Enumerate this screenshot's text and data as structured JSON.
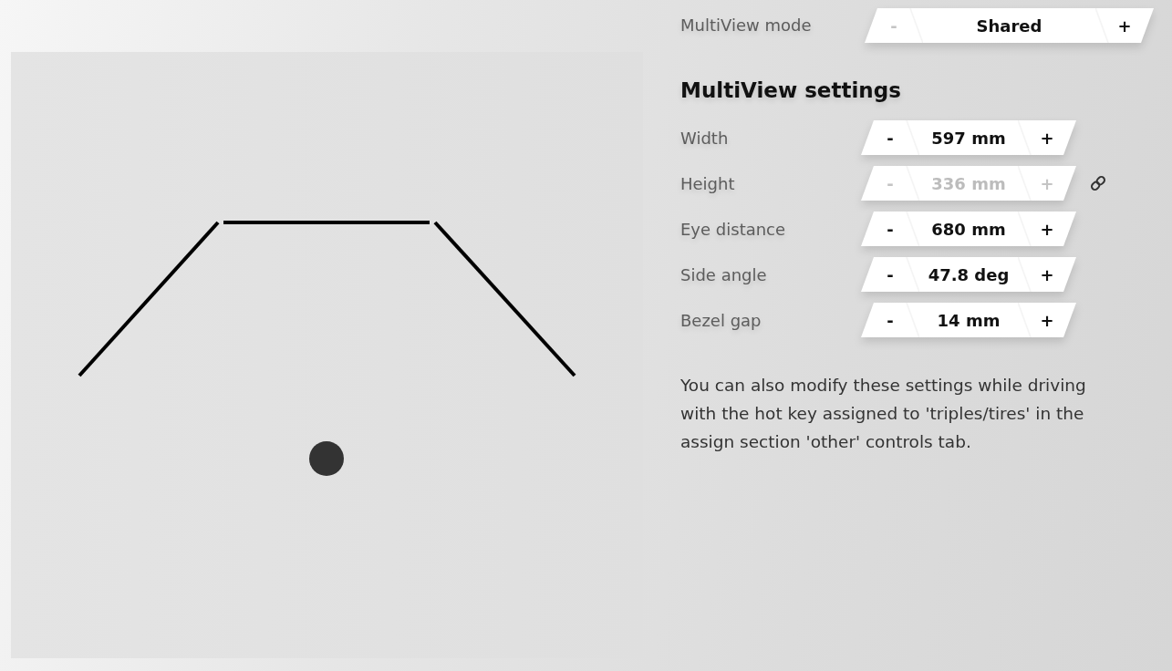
{
  "mode": {
    "label": "MultiView mode",
    "stepper": {
      "minus": {
        "text": "-",
        "disabled": true
      },
      "value": "Shared",
      "disabled": false,
      "plus": {
        "text": "+",
        "disabled": false
      }
    }
  },
  "settings": {
    "title": "MultiView settings",
    "rows": [
      {
        "label": "Width",
        "linked": false,
        "stepper": {
          "minus": {
            "text": "-",
            "disabled": false
          },
          "value": "597 mm",
          "disabled": false,
          "plus": {
            "text": "+",
            "disabled": false
          }
        }
      },
      {
        "label": "Height",
        "linked": true,
        "stepper": {
          "minus": {
            "text": "-",
            "disabled": true
          },
          "value": "336 mm",
          "disabled": true,
          "plus": {
            "text": "+",
            "disabled": true
          }
        }
      },
      {
        "label": "Eye distance",
        "linked": false,
        "stepper": {
          "minus": {
            "text": "-",
            "disabled": false
          },
          "value": "680 mm",
          "disabled": false,
          "plus": {
            "text": "+",
            "disabled": false
          }
        }
      },
      {
        "label": "Side angle",
        "linked": false,
        "stepper": {
          "minus": {
            "text": "-",
            "disabled": false
          },
          "value": "47.8 deg",
          "disabled": false,
          "plus": {
            "text": "+",
            "disabled": false
          }
        }
      },
      {
        "label": "Bezel gap",
        "linked": false,
        "stepper": {
          "minus": {
            "text": "-",
            "disabled": false
          },
          "value": "14 mm",
          "disabled": false,
          "plus": {
            "text": "+",
            "disabled": false
          }
        }
      }
    ]
  },
  "note": "You can also modify these settings while driving with the hot key assigned to 'triples/tires' in the assign section 'other' controls tab."
}
